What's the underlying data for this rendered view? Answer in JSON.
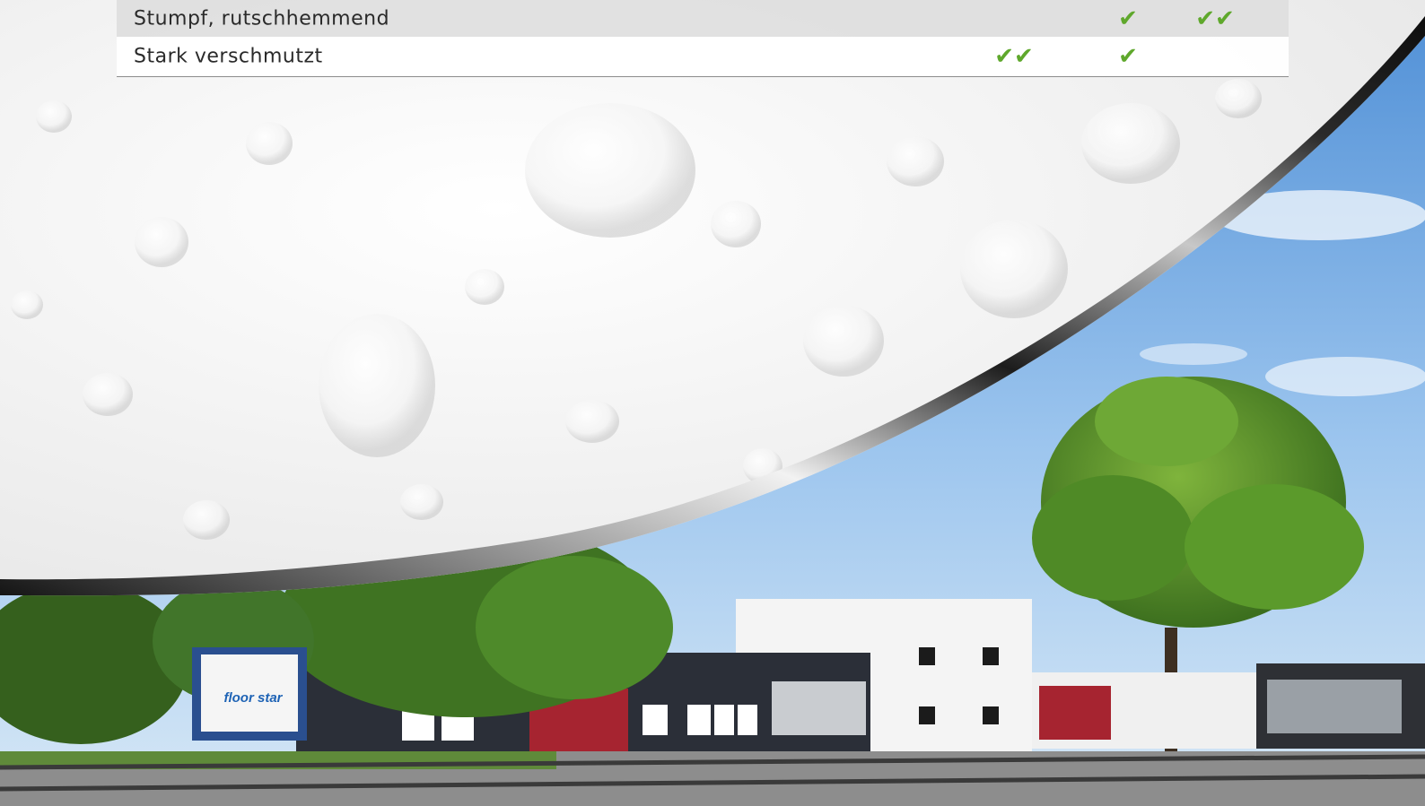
{
  "table": {
    "rows": [
      {
        "label": "Stumpf, rutschhemmend",
        "marks": [
          "",
          "✔",
          "✔✔"
        ]
      },
      {
        "label": "Stark verschmutzt",
        "marks": [
          "✔✔",
          "✔",
          ""
        ]
      }
    ]
  },
  "photo": {
    "sign_logo_text": "floor star"
  },
  "colors": {
    "check_mark": "#5fa82c",
    "header_row_fill": "#dedede",
    "row_fill": "#ffffff",
    "sky_top": "#4f8fd6",
    "sky_bottom": "#cfe3f5"
  }
}
